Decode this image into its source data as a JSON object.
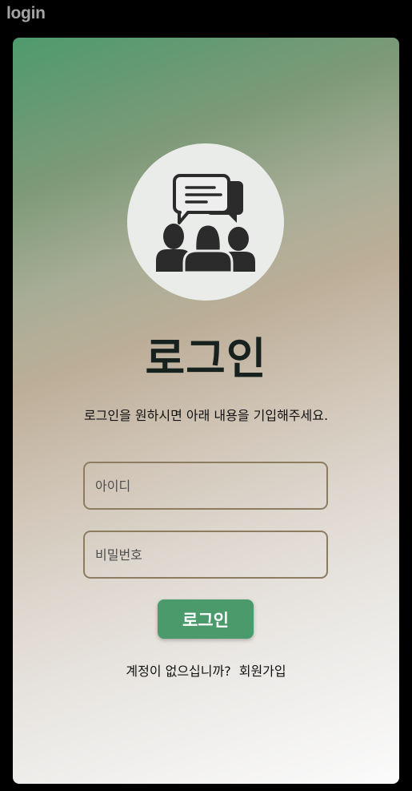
{
  "window": {
    "title": "login"
  },
  "logo": {
    "icon": "chat-group-icon"
  },
  "login": {
    "title": "로그인",
    "subtitle": "로그인을 원하시면 아래 내용을 기입해주세요.",
    "id_placeholder": "아이디",
    "id_value": "",
    "password_placeholder": "비밀번호",
    "password_value": "",
    "button_label": "로그인",
    "no_account_text": "계정이 없으십니까?",
    "signup_link": "회원가입"
  },
  "colors": {
    "accent": "#4a9a6c",
    "field_border": "#8c7d62",
    "title_text": "#17221f",
    "background": "#000000"
  }
}
